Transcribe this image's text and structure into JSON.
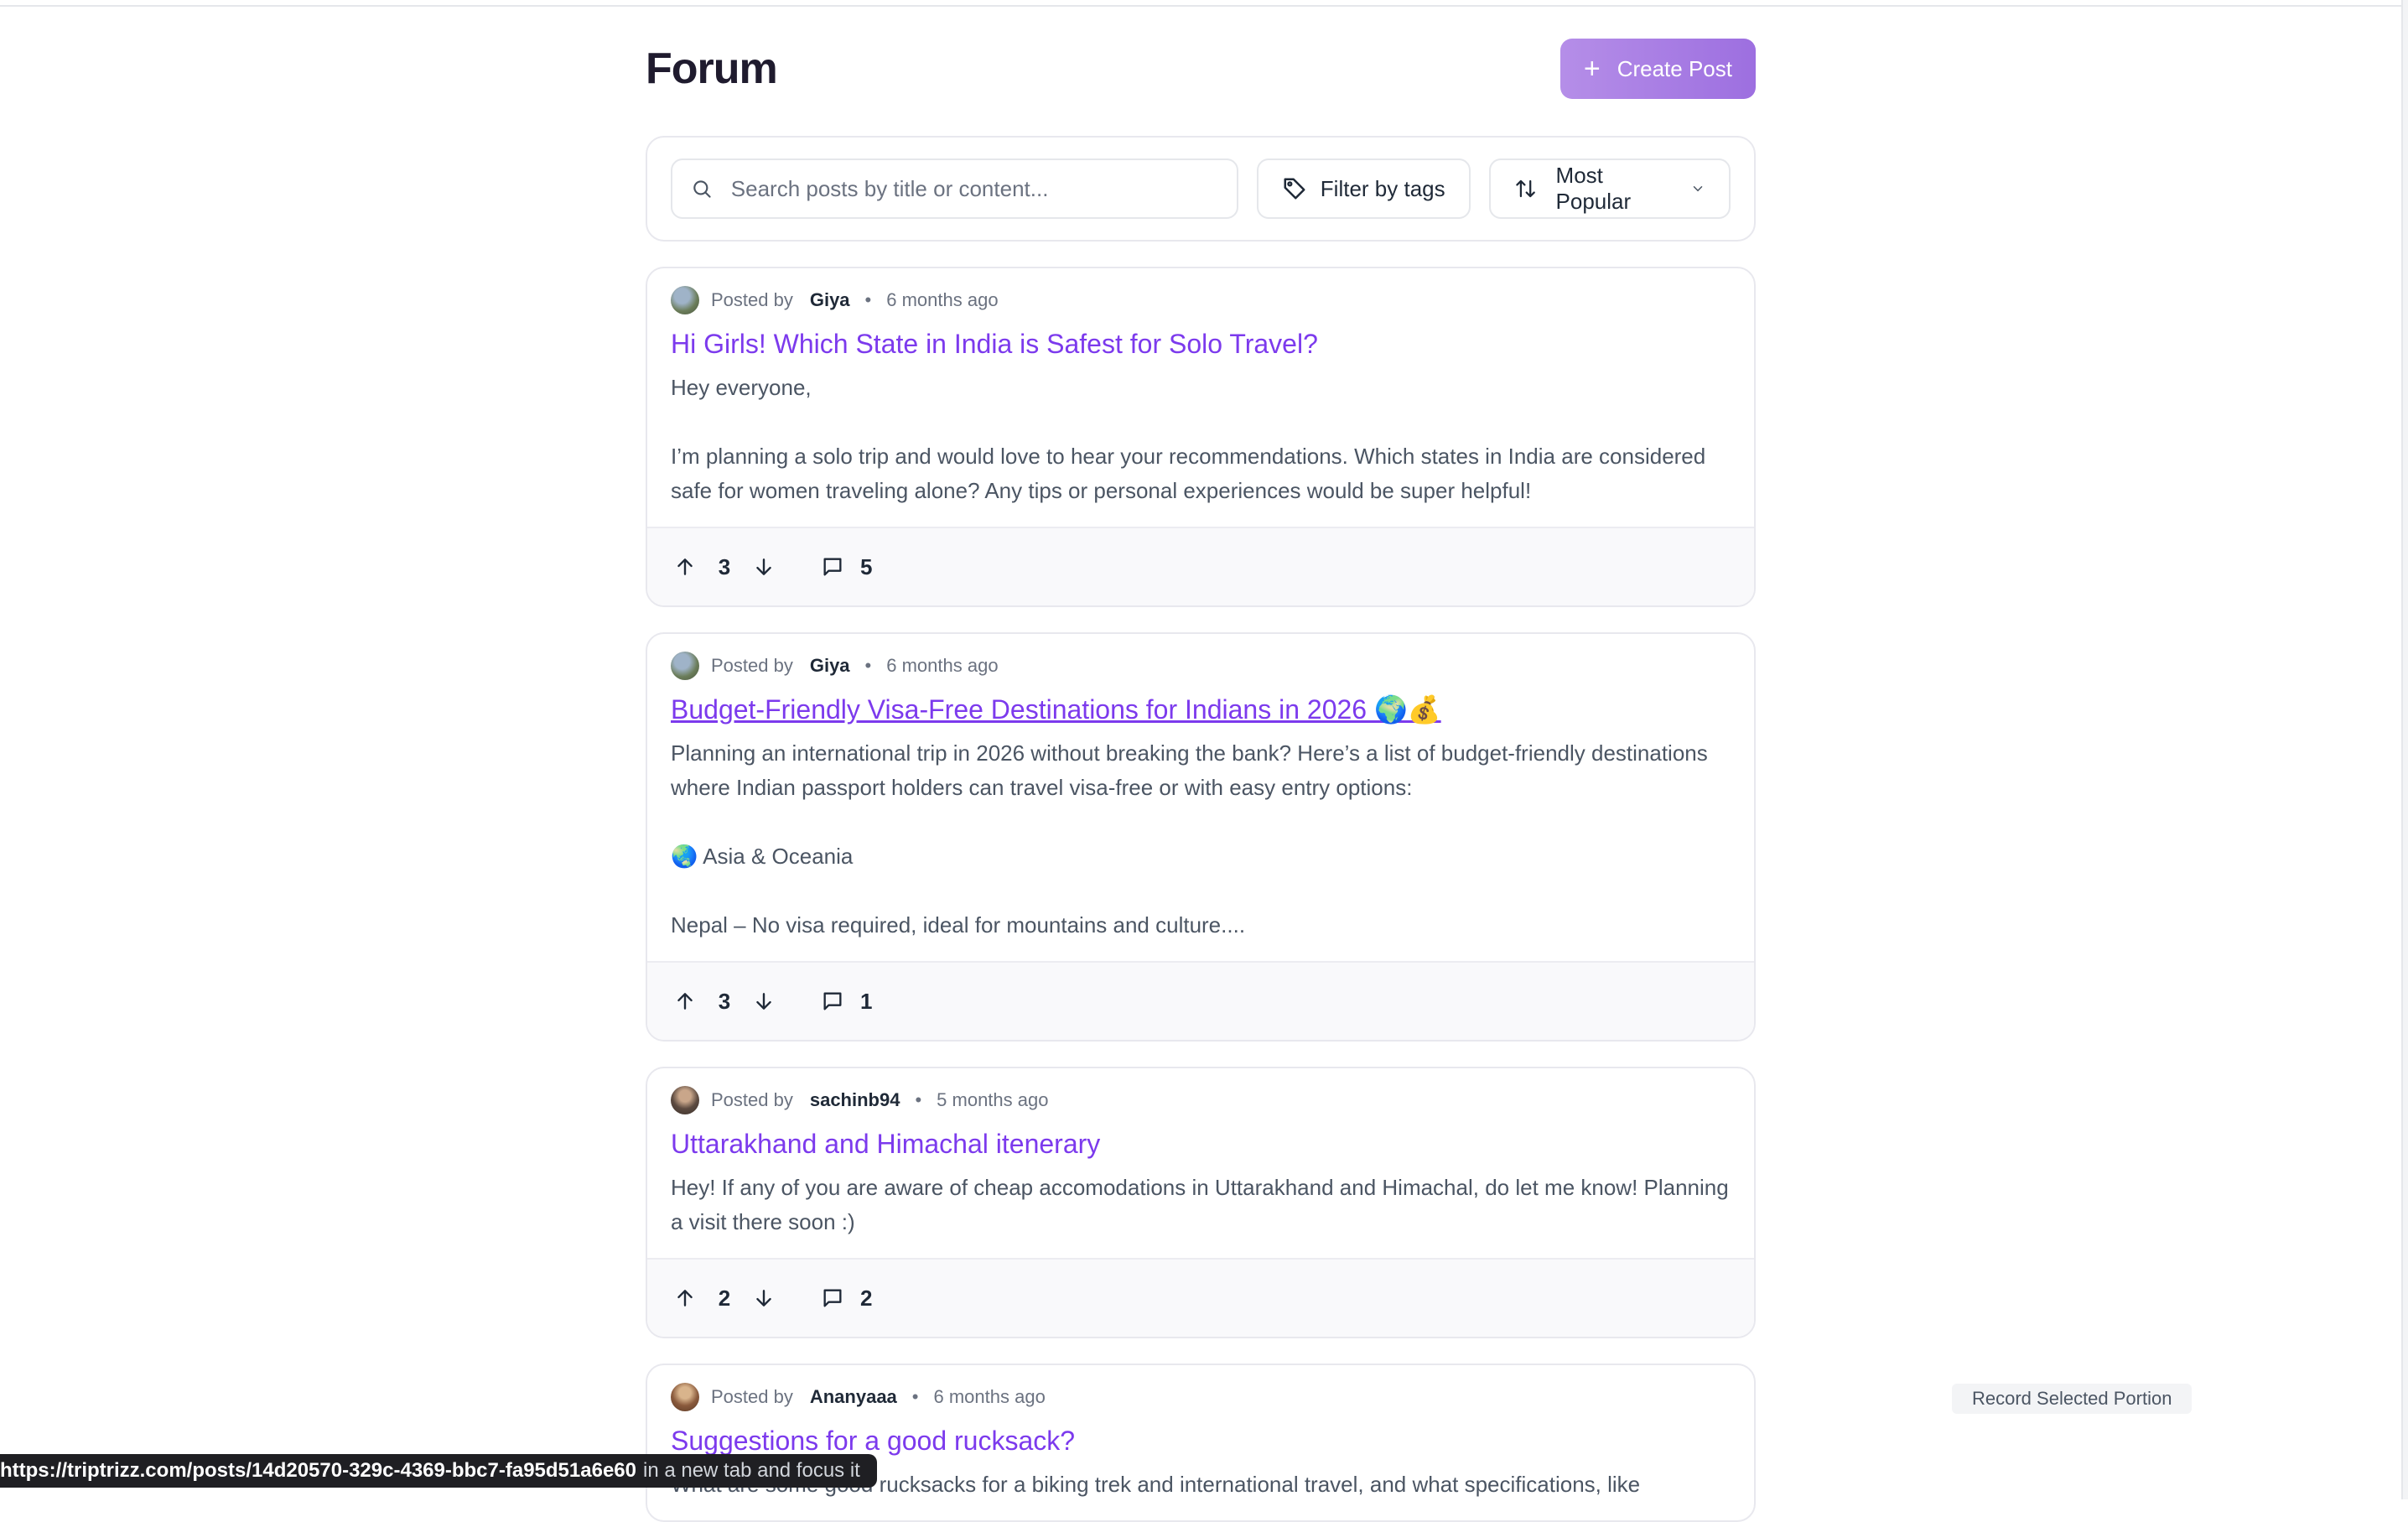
{
  "header": {
    "title": "Forum",
    "create_label": "Create Post"
  },
  "toolbar": {
    "search_placeholder": "Search posts by title or content...",
    "filter_label": "Filter by tags",
    "sort_label": "Most Popular"
  },
  "posts": [
    {
      "posted_by": "Posted by",
      "author": "Giya",
      "time": "6 months ago",
      "title": "Hi Girls! Which State in India is Safest for Solo Travel?",
      "excerpt": "Hey everyone,\n\nI’m planning a solo trip and would love to hear your recommendations. Which states in India are considered safe for women traveling alone? Any tips or personal experiences would be super helpful!",
      "votes": "3",
      "comments": "5",
      "avatar_color": "#7a8b6f"
    },
    {
      "posted_by": "Posted by",
      "author": "Giya",
      "time": "6 months ago",
      "title": "Budget-Friendly Visa-Free Destinations for Indians in 2026 🌍💰",
      "excerpt": "Planning an international trip in 2026 without breaking the bank? Here’s a list of budget-friendly destinations where Indian passport holders can travel visa-free or with easy entry options:\n\n🌏 Asia & Oceania\n\nNepal – No visa required, ideal for mountains and culture....",
      "votes": "3",
      "comments": "1",
      "avatar_color": "#7a8b6f"
    },
    {
      "posted_by": "Posted by",
      "author": "sachinb94",
      "time": "5 months ago",
      "title": "Uttarakhand and Himachal itenerary",
      "excerpt": "Hey! If any of you are aware of cheap accomodations in Uttarakhand and Himachal, do let me know! Planning a visit there soon :)",
      "votes": "2",
      "comments": "2",
      "avatar_color": "#6b5a4e"
    },
    {
      "posted_by": "Posted by",
      "author": "Ananyaaa",
      "time": "6 months ago",
      "title": "Suggestions for a good rucksack?",
      "excerpt": "What are some good rucksacks for a biking trek and international travel, and what specifications, like",
      "avatar_color": "#8a5a3c"
    }
  ],
  "status_bar": {
    "url": "https://triptrizz.com/posts/14d20570-329c-4369-bbc7-fa95d51a6e60",
    "action": "in a new tab and focus it"
  },
  "record_label": "Record Selected Portion",
  "colors": {
    "accent": "#7c3aed",
    "button_gradient_start": "#b58ee8",
    "button_gradient_end": "#9d6fe0"
  }
}
